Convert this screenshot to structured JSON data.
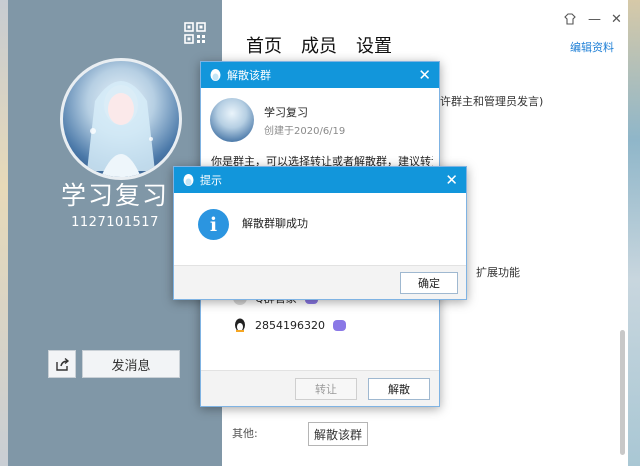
{
  "profile": {
    "group_name": "学习复习",
    "group_id": "1127101517",
    "send_label": "发消息"
  },
  "tabs": [
    "首页",
    "成员",
    "设置"
  ],
  "window_controls": {
    "close": "✕"
  },
  "edit_label": "编辑资料",
  "background_text": {
    "line1": "许群主和管理员发言)",
    "line2": "扩展功能",
    "other_label": "其他:",
    "dissolve_label": "解散该群"
  },
  "dissolve_dialog": {
    "title": "解散该群",
    "group_name": "学习复习",
    "created": "创建于2020/6/19",
    "description": "你是群主，可以选择转让或者解散群，建议转让",
    "member1": "Q群管家",
    "member2": "2854196320",
    "transfer_label": "转让",
    "dissolve_label": "解散"
  },
  "tip_dialog": {
    "title": "提示",
    "message": "解散群聊成功",
    "ok_label": "确定"
  },
  "icons": {
    "info": "i",
    "close": "✕"
  },
  "colors": {
    "accent": "#1296db",
    "profile_panel": "#8097a7",
    "link": "#1e7fd6"
  }
}
